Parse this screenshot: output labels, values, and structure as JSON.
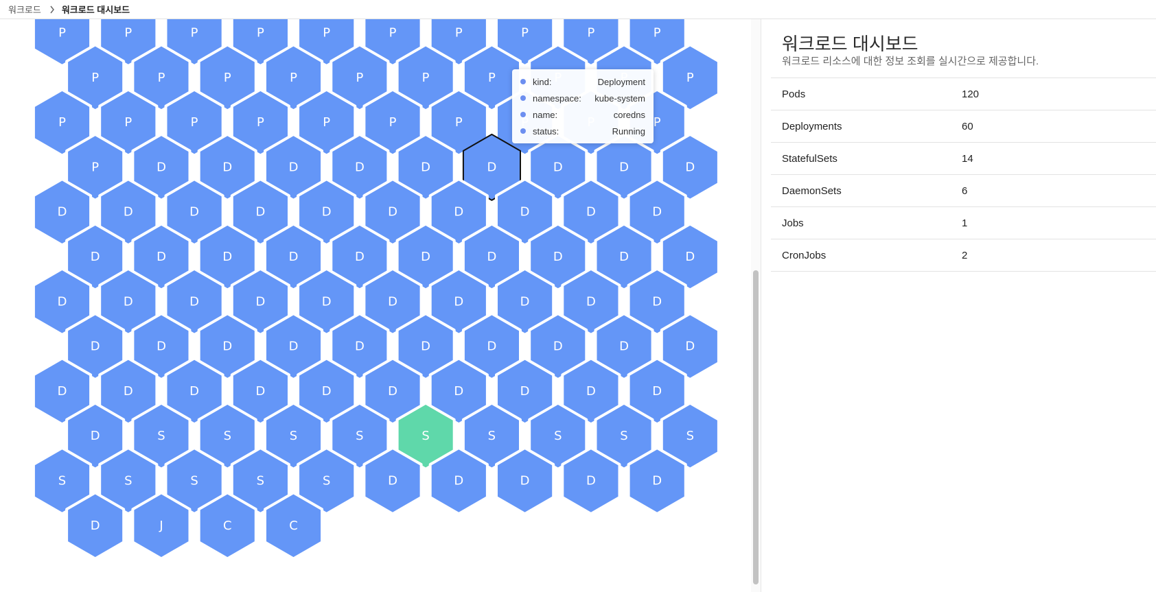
{
  "breadcrumb": {
    "parent": "워크로드",
    "separator_icon": "chevron-right-icon",
    "current": "워크로드 대시보드"
  },
  "colors": {
    "hex_default": "#6496f7",
    "hex_highlight": "#5fd8aa",
    "hex_selected_border": "#111111",
    "tooltip_dot": "#6d8ff0"
  },
  "hexgrid": {
    "rows": [
      [
        "P",
        "P",
        "P",
        "P",
        "P",
        "P",
        "P",
        "P",
        "P",
        "P"
      ],
      [
        "P",
        "P",
        "P",
        "P",
        "P",
        "P",
        "P",
        "P",
        "P",
        "P"
      ],
      [
        "P",
        "P",
        "P",
        "P",
        "P",
        "P",
        "P",
        "P",
        "P",
        "P"
      ],
      [
        "P",
        "D",
        "D",
        "D",
        "D",
        "D",
        "D",
        "D",
        "D",
        "D"
      ],
      [
        "D",
        "D",
        "D",
        "D",
        "D",
        "D",
        "D",
        "D",
        "D",
        "D"
      ],
      [
        "D",
        "D",
        "D",
        "D",
        "D",
        "D",
        "D",
        "D",
        "D",
        "D"
      ],
      [
        "D",
        "D",
        "D",
        "D",
        "D",
        "D",
        "D",
        "D",
        "D",
        "D"
      ],
      [
        "D",
        "D",
        "D",
        "D",
        "D",
        "D",
        "D",
        "D",
        "D",
        "D"
      ],
      [
        "D",
        "D",
        "D",
        "D",
        "D",
        "D",
        "D",
        "D",
        "D",
        "D"
      ],
      [
        "D",
        "S",
        "S",
        "S",
        "S",
        "S",
        "S",
        "S",
        "S",
        "S"
      ],
      [
        "S",
        "S",
        "S",
        "S",
        "S",
        "D",
        "D",
        "D",
        "D",
        "D"
      ],
      [
        "D",
        "J",
        "C",
        "C"
      ]
    ],
    "selected_cell": [
      3,
      6
    ],
    "highlighted_cell": [
      9,
      5
    ]
  },
  "tooltip": {
    "rows": [
      {
        "key": "kind:",
        "value": "Deployment"
      },
      {
        "key": "namespace:",
        "value": "kube-system"
      },
      {
        "key": "name:",
        "value": "coredns"
      },
      {
        "key": "status:",
        "value": "Running"
      }
    ]
  },
  "panel": {
    "title": "워크로드 대시보드",
    "subtitle": "워크로드 리소스에 대한 정보 조회를 실시간으로 제공합니다.",
    "stats": [
      {
        "label": "Pods",
        "value": "120"
      },
      {
        "label": "Deployments",
        "value": "60"
      },
      {
        "label": "StatefulSets",
        "value": "14"
      },
      {
        "label": "DaemonSets",
        "value": "6"
      },
      {
        "label": "Jobs",
        "value": "1"
      },
      {
        "label": "CronJobs",
        "value": "2"
      }
    ]
  }
}
